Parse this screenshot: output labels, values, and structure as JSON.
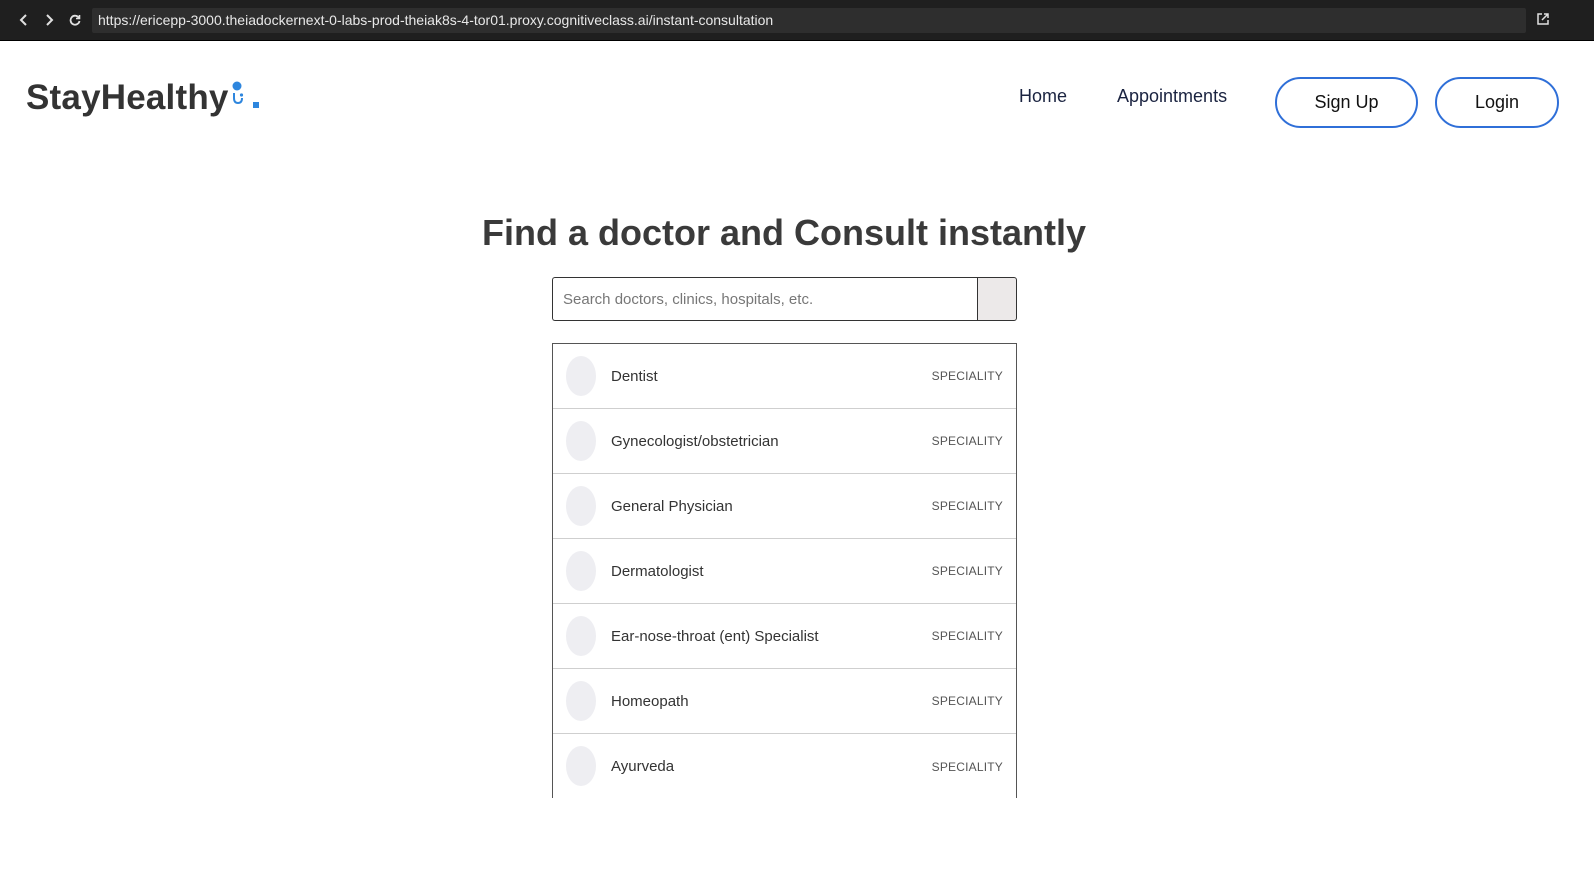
{
  "browser": {
    "url": "https://ericepp-3000.theiadockernext-0-labs-prod-theiak8s-4-tor01.proxy.cognitiveclass.ai/instant-consultation",
    "icons": [
      "back-icon",
      "forward-icon",
      "reload-icon",
      "open-external-icon"
    ]
  },
  "header": {
    "logo_text": "StayHealthy",
    "logo_suffix": ".",
    "nav": {
      "home": "Home",
      "appointments": "Appointments"
    },
    "buttons": {
      "signup": "Sign Up",
      "login": "Login"
    },
    "colors": {
      "accent": "#2f6fd8",
      "logo_icon": "#2e86de"
    }
  },
  "main": {
    "heading": "Find a doctor and Consult instantly",
    "search": {
      "placeholder": "Search doctors, clinics, hospitals, etc.",
      "value": ""
    },
    "specialities": [
      {
        "name": "Dentist",
        "tag": "SPECIALITY"
      },
      {
        "name": "Gynecologist/obstetrician",
        "tag": "SPECIALITY"
      },
      {
        "name": "General Physician",
        "tag": "SPECIALITY"
      },
      {
        "name": "Dermatologist",
        "tag": "SPECIALITY"
      },
      {
        "name": "Ear-nose-throat (ent) Specialist",
        "tag": "SPECIALITY"
      },
      {
        "name": "Homeopath",
        "tag": "SPECIALITY"
      },
      {
        "name": "Ayurveda",
        "tag": "SPECIALITY"
      }
    ]
  }
}
